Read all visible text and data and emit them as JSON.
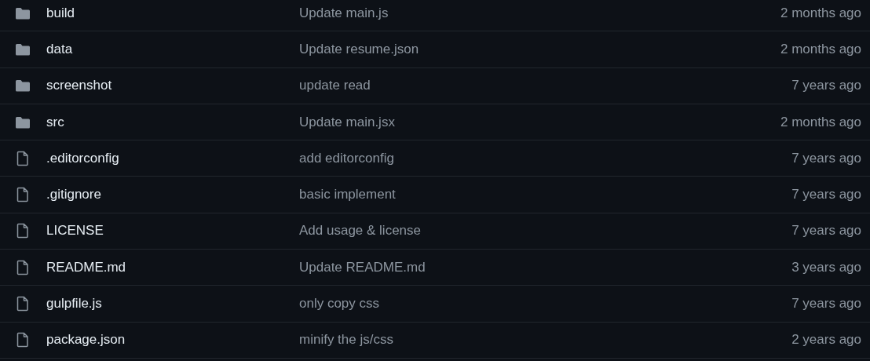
{
  "files": [
    {
      "kind": "folder",
      "name": "build",
      "message": "Update main.js",
      "age": "2 months ago"
    },
    {
      "kind": "folder",
      "name": "data",
      "message": "Update resume.json",
      "age": "2 months ago"
    },
    {
      "kind": "folder",
      "name": "screenshot",
      "message": "update read",
      "age": "7 years ago"
    },
    {
      "kind": "folder",
      "name": "src",
      "message": "Update main.jsx",
      "age": "2 months ago"
    },
    {
      "kind": "file",
      "name": ".editorconfig",
      "message": "add editorconfig",
      "age": "7 years ago"
    },
    {
      "kind": "file",
      "name": ".gitignore",
      "message": "basic implement",
      "age": "7 years ago"
    },
    {
      "kind": "file",
      "name": "LICENSE",
      "message": "Add usage & license",
      "age": "7 years ago"
    },
    {
      "kind": "file",
      "name": "README.md",
      "message": "Update README.md",
      "age": "3 years ago"
    },
    {
      "kind": "file",
      "name": "gulpfile.js",
      "message": "only copy css",
      "age": "7 years ago"
    },
    {
      "kind": "file",
      "name": "package.json",
      "message": "minify the js/css",
      "age": "2 years ago"
    }
  ]
}
